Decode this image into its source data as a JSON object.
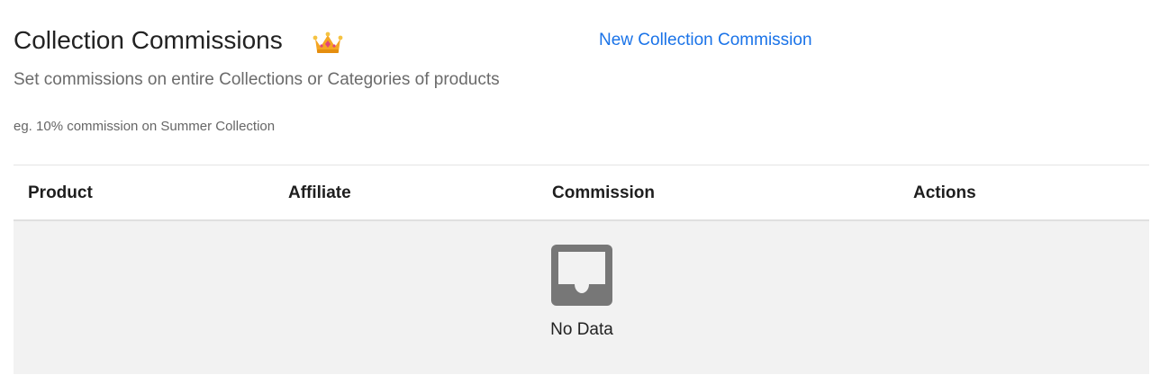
{
  "header": {
    "title": "Collection Commissions",
    "premium_icon": "crown-icon",
    "new_link_label": "New Collection Commission",
    "subtitle": "Set commissions on entire Collections or Categories of products",
    "example": "eg. 10% commission on Summer Collection"
  },
  "table": {
    "columns": [
      "Product",
      "Affiliate",
      "Commission",
      "Actions"
    ],
    "rows": [],
    "empty_icon": "inbox-icon",
    "empty_text": "No Data"
  },
  "colors": {
    "link": "#1a73e8",
    "empty_background": "#f2f2f2",
    "empty_icon": "#777777",
    "crown": "#f5a623"
  }
}
